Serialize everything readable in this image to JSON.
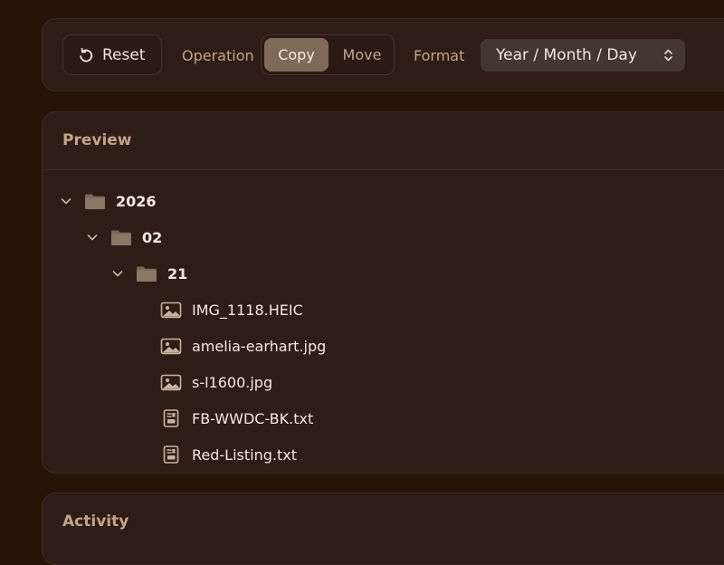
{
  "toolbar": {
    "reset_label": "Reset",
    "operation_label": "Operation",
    "operation_options": [
      "Copy",
      "Move"
    ],
    "operation_selected": "Copy",
    "format_label": "Format",
    "format_value": "Year / Month / Day"
  },
  "preview": {
    "title": "Preview",
    "tree": {
      "year": "2026",
      "month": "02",
      "day": "21",
      "files": [
        {
          "name": "IMG_1118.HEIC",
          "type": "image"
        },
        {
          "name": "amelia-earhart.jpg",
          "type": "image"
        },
        {
          "name": "s-l1600.jpg",
          "type": "image"
        },
        {
          "name": "FB-WWDC-BK.txt",
          "type": "text"
        },
        {
          "name": "Red-Listing.txt",
          "type": "text"
        }
      ]
    }
  },
  "activity": {
    "title": "Activity"
  },
  "colors": {
    "background": "#261407",
    "panel": "#2e1d16",
    "accent": "#7e6a57",
    "label": "#c3a48a",
    "text": "#f1e8e0",
    "icon": "#c9b39e"
  },
  "icons": {
    "reset": "reset-icon",
    "select": "chevron-up-down-icon",
    "folder": "folder-icon",
    "image_file": "image-file-icon",
    "text_file": "text-file-icon",
    "expand": "chevron-down-icon"
  }
}
